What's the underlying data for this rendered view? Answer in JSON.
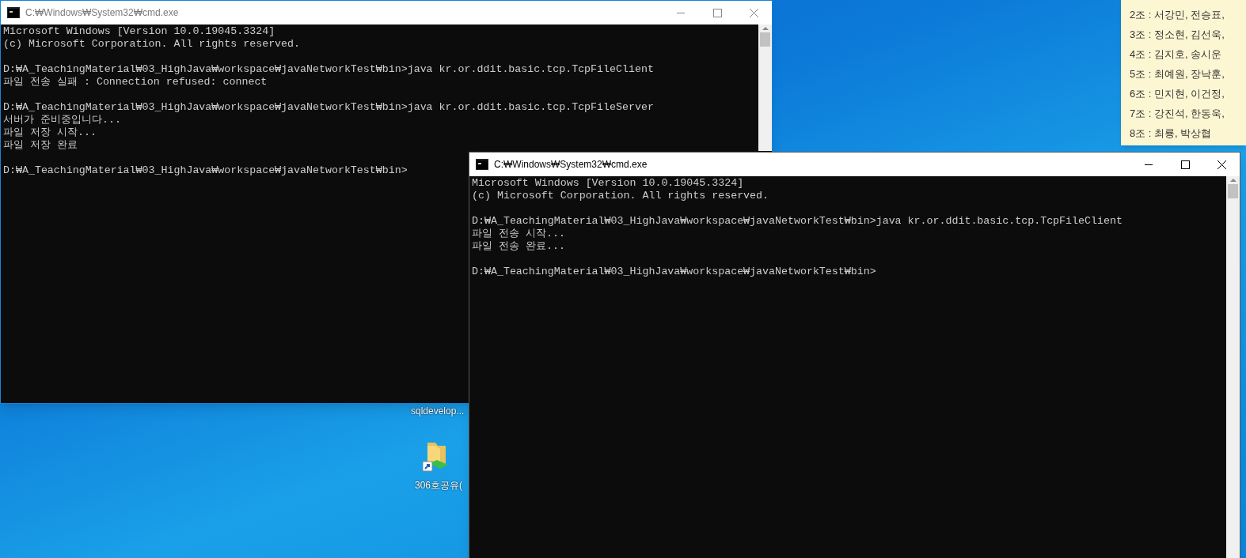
{
  "desktop_icons": [
    {
      "label": "sqldevelop...",
      "kind": "app"
    },
    {
      "label": "306호공유(",
      "kind": "shared-folder"
    }
  ],
  "sticky_note": {
    "lines": [
      "2조 : 서강민, 전승표,",
      "3조 : 정소현, 김선욱,",
      "4조 : 김지호, 송시운",
      "5조 : 최예원, 장낙훈,",
      "6조 : 민지현, 이건정,",
      "7조 : 강진석, 한동욱,",
      "8조 : 최룡, 박상협"
    ]
  },
  "windows": [
    {
      "title": "C:₩Windows₩System32₩cmd.exe",
      "active": false,
      "blocks": [
        [
          "Microsoft Windows [Version 10.0.19045.3324]",
          "(c) Microsoft Corporation. All rights reserved."
        ],
        [
          "D:₩A_TeachingMaterial₩03_HighJava₩workspace₩javaNetworkTest₩bin>java kr.or.ddit.basic.tcp.TcpFileClient",
          "파일 전송 실패 : Connection refused: connect"
        ],
        [
          "D:₩A_TeachingMaterial₩03_HighJava₩workspace₩javaNetworkTest₩bin>java kr.or.ddit.basic.tcp.TcpFileServer",
          "서버가 준비중입니다...",
          "파일 저장 시작...",
          "파일 저장 완료"
        ],
        [
          "D:₩A_TeachingMaterial₩03_HighJava₩workspace₩javaNetworkTest₩bin>"
        ]
      ]
    },
    {
      "title": "C:₩Windows₩System32₩cmd.exe",
      "active": true,
      "blocks": [
        [
          "Microsoft Windows [Version 10.0.19045.3324]",
          "(c) Microsoft Corporation. All rights reserved."
        ],
        [
          "D:₩A_TeachingMaterial₩03_HighJava₩workspace₩javaNetworkTest₩bin>java kr.or.ddit.basic.tcp.TcpFileClient",
          "파일 전송 시작...",
          "파일 전송 완료..."
        ],
        [
          "D:₩A_TeachingMaterial₩03_HighJava₩workspace₩javaNetworkTest₩bin>"
        ]
      ]
    }
  ]
}
